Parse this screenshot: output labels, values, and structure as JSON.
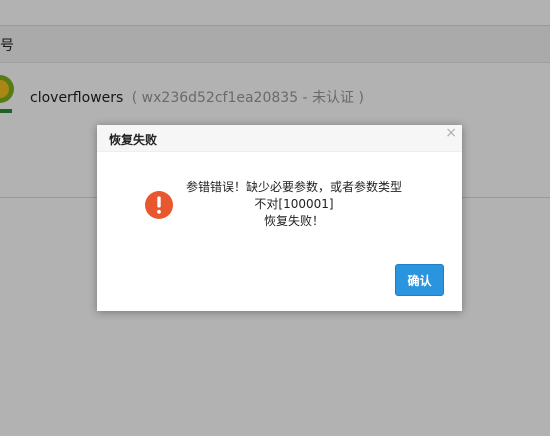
{
  "table": {
    "header_label": "号"
  },
  "account": {
    "name": "cloverflowers",
    "meta": "( wx236d52cf1ea20835 - 未认证 )",
    "logo_icon": "clover-logo-icon"
  },
  "dialog": {
    "title": "恢复失败",
    "close_glyph": "×",
    "icon": "alert-circle-icon",
    "message_lines": [
      "参错错误！缺少必要参数，或者参数类型",
      "不对[100001]",
      "恢复失败！"
    ],
    "ok_label": "确认"
  },
  "colors": {
    "accent": "#2b94de",
    "alert": "#e8572e"
  }
}
